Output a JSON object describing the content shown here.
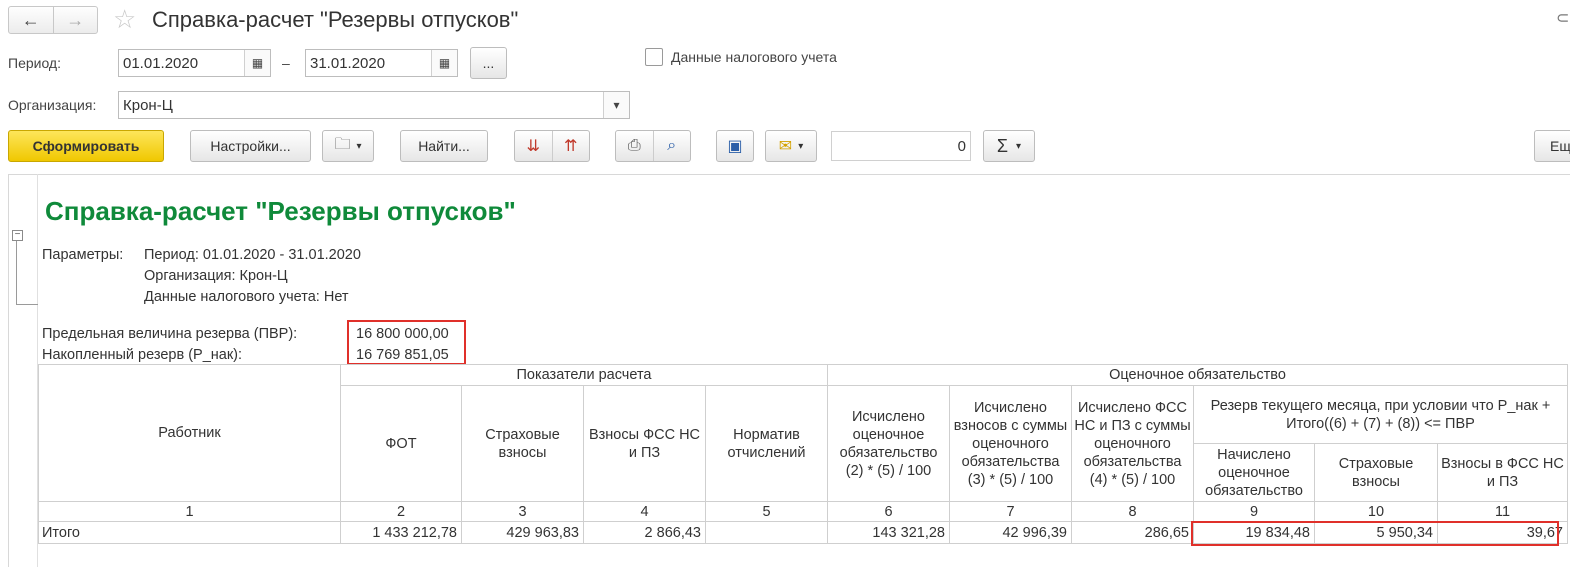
{
  "window": {
    "title": "Справка-расчет \"Резервы отпусков\"",
    "nav_back_glyph": "←",
    "nav_forward_glyph": "→",
    "favorite_glyph": "☆"
  },
  "filters": {
    "period_label": "Период:",
    "period_from": "01.01.2020",
    "period_to": "31.01.2020",
    "period_dash": "–",
    "period_more_label": "...",
    "tax_data_label": "Данные налогового учета",
    "tax_data_checked": false,
    "organization_label": "Организация:",
    "organization_value": "Крон-Ц"
  },
  "toolbar": {
    "generate_label": "Сформировать",
    "settings_label": "Настройки...",
    "find_label": "Найти...",
    "number_value": "0",
    "more_label": "Еще",
    "sigma_glyph": "Σ"
  },
  "colors": {
    "accent_yellow": "#f0c800",
    "report_title_green": "#0f8a3a",
    "highlight_red": "#e0302a"
  },
  "report": {
    "title": "Справка-расчет \"Резервы отпусков\"",
    "params_label": "Параметры:",
    "param_period": "Период: 01.01.2020 - 31.01.2020",
    "param_org": "Организация: Крон-Ц",
    "param_tax": "Данные налогового учета: Нет",
    "pvr_label": "Предельная величина резерва (ПВР):",
    "pvr_value": "16 800 000,00",
    "pnak_label": "Накопленный резерв (Р_нак):",
    "pnak_value": "16 769 851,05",
    "header": {
      "employee": "Работник",
      "group_calc": "Показатели расчета",
      "group_estimate": "Оценочное обязательство",
      "fot": "ФОТ",
      "insurance": "Страховые взносы",
      "fss": "Взносы ФСС НС и ПЗ",
      "norm": "Норматив отчислений",
      "calc_estimate": "Исчислено оценочное обязательство (2) * (5) / 100",
      "calc_contrib": "Исчислено взносов с суммы оценочного обязательства (3) * (5) / 100",
      "calc_fss": "Исчислено ФСС НС и ПЗ с суммы оценочного обязательства (4) * (5) / 100",
      "reserve_current": "Резерв текущего месяца, при условии что Р_нак + Итого((6) + (7) + (8)) <= ПВР",
      "accrued": "Начислено оценочное обязательство",
      "insurance2": "Страховые взносы",
      "fss2": "Взносы в ФСС НС и ПЗ"
    },
    "col_numbers": [
      "1",
      "2",
      "3",
      "4",
      "5",
      "6",
      "7",
      "8",
      "9",
      "10",
      "11"
    ],
    "total_row": {
      "label": "Итого",
      "values": [
        "1 433 212,78",
        "429 963,83",
        "2 866,43",
        "",
        "143 321,28",
        "42 996,39",
        "286,65",
        "19 834,48",
        "5 950,34",
        "39,67"
      ]
    }
  }
}
